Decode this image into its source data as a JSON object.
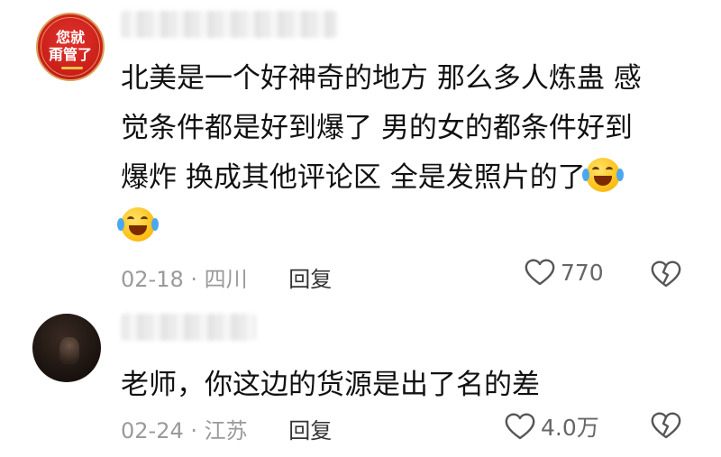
{
  "comments": [
    {
      "avatar_text_1": "您就",
      "avatar_text_2": "甭管了",
      "lines": [
        "北美是一个好神奇的地方 那么多人炼蛊 感",
        "觉条件都是好到爆了 男的女的都条件好到",
        "爆炸 换成其他评论区 全是发照片的了"
      ],
      "emoji_names": [
        "laugh-cry-emoji",
        "laugh-cry-emoji"
      ],
      "date": "02-18",
      "location": "四川",
      "reply_label": "回复",
      "like_count": "770"
    },
    {
      "text": "老师，你这边的货源是出了名的差",
      "date": "02-24",
      "location": "江苏",
      "reply_label": "回复",
      "like_count": "4.0万"
    }
  ],
  "icons": {
    "like": "heart-outline-icon",
    "dislike": "broken-heart-icon"
  },
  "colors": {
    "text": "#111111",
    "meta": "#9a9a9a",
    "avatar_red": "#c81e18"
  }
}
